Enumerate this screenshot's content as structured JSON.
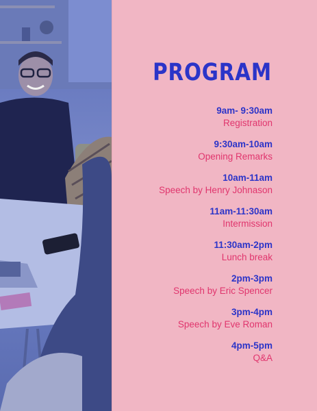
{
  "title": "PROGRAM",
  "schedule": [
    {
      "time": "9am- 9:30am",
      "event": "Registration"
    },
    {
      "time": "9:30am-10am",
      "event": "Opening Remarks"
    },
    {
      "time": "10am-11am",
      "event": "Speech by Henry Johnason"
    },
    {
      "time": "11am-11:30am",
      "event": "Intermission"
    },
    {
      "time": "11:30am-2pm",
      "event": "Lunch break"
    },
    {
      "time": "2pm-3pm",
      "event": "Speech by Eric Spencer"
    },
    {
      "time": "3pm-4pm",
      "event": "Speech by Eve Roman"
    },
    {
      "time": "4pm-5pm",
      "event": "Q&A"
    }
  ],
  "colors": {
    "background": "#f1b6c4",
    "title": "#2b34c8",
    "time": "#2b34c8",
    "event": "#e0356d",
    "photo_tint": "#5c6fb8"
  }
}
